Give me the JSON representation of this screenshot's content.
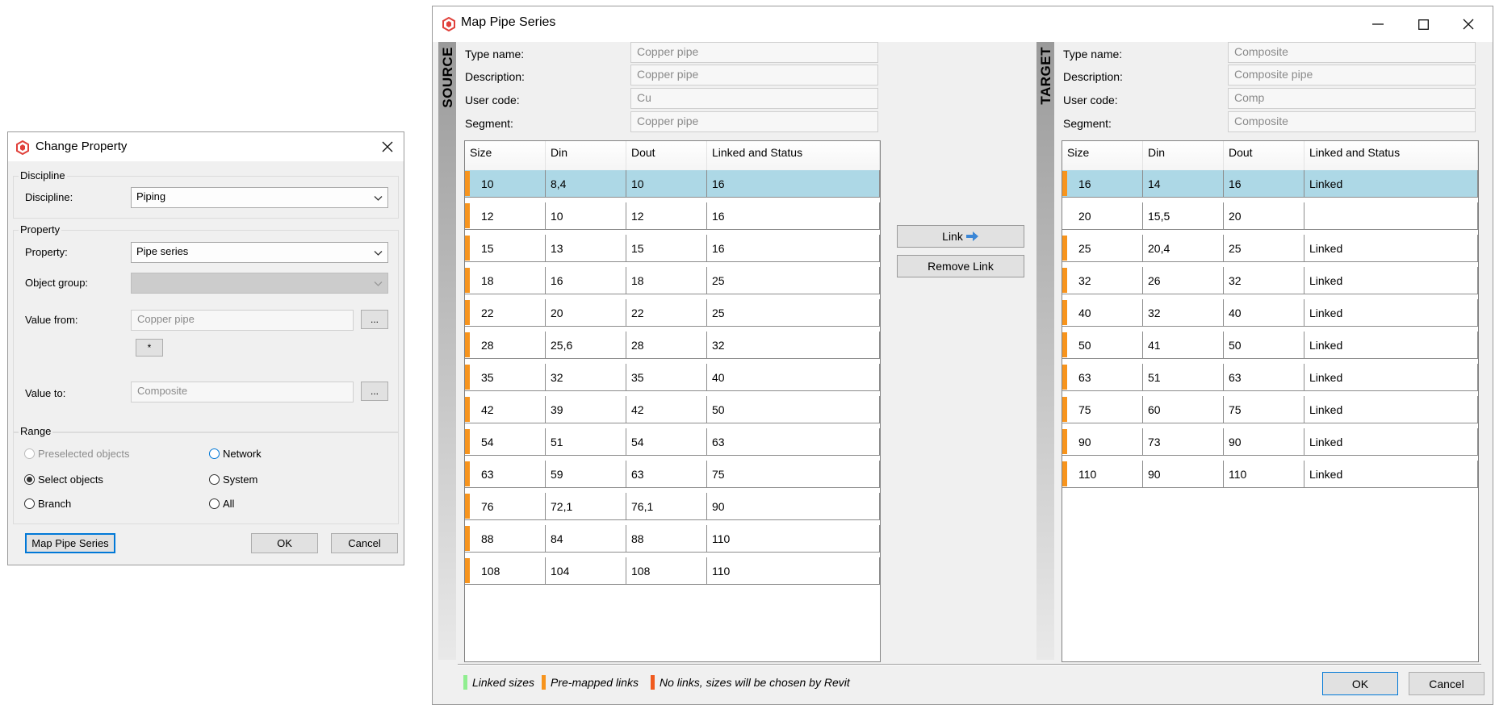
{
  "change_property": {
    "title": "Change Property",
    "discipline_group": "Discipline",
    "discipline_label": "Discipline:",
    "discipline_value": "Piping",
    "property_group": "Property",
    "property_label": "Property:",
    "property_value": "Pipe series",
    "object_group_label": "Object group:",
    "object_group_value": "",
    "value_from_label": "Value from:",
    "value_from": "Copper pipe",
    "browse": "...",
    "star_button": "*",
    "value_to_label": "Value to:",
    "value_to": "Composite",
    "range_group": "Range",
    "range": {
      "preselected": "Preselected objects",
      "select_objects": "Select objects",
      "branch": "Branch",
      "network": "Network",
      "system": "System",
      "all": "All"
    },
    "map_pipe_series_button": "Map Pipe Series",
    "ok": "OK",
    "cancel": "Cancel"
  },
  "map_pipe_series": {
    "title": "Map Pipe Series",
    "source": {
      "side_label": "SOURCE",
      "type_name_label": "Type name:",
      "type_name": "Copper pipe",
      "description_label": "Description:",
      "description": "Copper pipe",
      "user_code_label": "User code:",
      "user_code": "Cu",
      "segment_label": "Segment:",
      "segment": "Copper pipe"
    },
    "target": {
      "side_label": "TARGET",
      "type_name_label": "Type name:",
      "type_name": "Composite",
      "description_label": "Description:",
      "description": "Composite pipe",
      "user_code_label": "User code:",
      "user_code": "Comp",
      "segment_label": "Segment:",
      "segment": "Composite"
    },
    "columns": [
      "Size",
      "Din",
      "Dout",
      "Linked and Status"
    ],
    "source_rows": [
      {
        "size": "10",
        "din": "8,4",
        "dout": "10",
        "status": "16",
        "marker": true,
        "selected": true
      },
      {
        "size": "12",
        "din": "10",
        "dout": "12",
        "status": "16",
        "marker": true
      },
      {
        "size": "15",
        "din": "13",
        "dout": "15",
        "status": "16",
        "marker": true
      },
      {
        "size": "18",
        "din": "16",
        "dout": "18",
        "status": "25",
        "marker": true
      },
      {
        "size": "22",
        "din": "20",
        "dout": "22",
        "status": "25",
        "marker": true
      },
      {
        "size": "28",
        "din": "25,6",
        "dout": "28",
        "status": "32",
        "marker": true
      },
      {
        "size": "35",
        "din": "32",
        "dout": "35",
        "status": "40",
        "marker": true
      },
      {
        "size": "42",
        "din": "39",
        "dout": "42",
        "status": "50",
        "marker": true
      },
      {
        "size": "54",
        "din": "51",
        "dout": "54",
        "status": "63",
        "marker": true
      },
      {
        "size": "63",
        "din": "59",
        "dout": "63",
        "status": "75",
        "marker": true
      },
      {
        "size": "76",
        "din": "72,1",
        "dout": "76,1",
        "status": "90",
        "marker": true
      },
      {
        "size": "88",
        "din": "84",
        "dout": "88",
        "status": "110",
        "marker": true
      },
      {
        "size": "108",
        "din": "104",
        "dout": "108",
        "status": "110",
        "marker": true
      }
    ],
    "target_rows": [
      {
        "size": "16",
        "din": "14",
        "dout": "16",
        "status": "Linked",
        "marker": true,
        "selected": true
      },
      {
        "size": "20",
        "din": "15,5",
        "dout": "20",
        "status": "",
        "marker": false
      },
      {
        "size": "25",
        "din": "20,4",
        "dout": "25",
        "status": "Linked",
        "marker": true
      },
      {
        "size": "32",
        "din": "26",
        "dout": "32",
        "status": "Linked",
        "marker": true
      },
      {
        "size": "40",
        "din": "32",
        "dout": "40",
        "status": "Linked",
        "marker": true
      },
      {
        "size": "50",
        "din": "41",
        "dout": "50",
        "status": "Linked",
        "marker": true
      },
      {
        "size": "63",
        "din": "51",
        "dout": "63",
        "status": "Linked",
        "marker": true
      },
      {
        "size": "75",
        "din": "60",
        "dout": "75",
        "status": "Linked",
        "marker": true
      },
      {
        "size": "90",
        "din": "73",
        "dout": "90",
        "status": "Linked",
        "marker": true
      },
      {
        "size": "110",
        "din": "90",
        "dout": "110",
        "status": "Linked",
        "marker": true
      }
    ],
    "link_button": "Link",
    "remove_link_button": "Remove Link",
    "legend": [
      {
        "label": "Linked sizes",
        "color": "#90ee90"
      },
      {
        "label": "Pre-mapped links",
        "color": "#f7941d"
      },
      {
        "label": "No links, sizes will be chosen by Revit",
        "color": "#f05a1e"
      }
    ],
    "ok": "OK",
    "cancel": "Cancel"
  },
  "colors": {
    "selection": "#add8e6",
    "premapped": "#f7941d",
    "app_icon": "#e0403a"
  }
}
